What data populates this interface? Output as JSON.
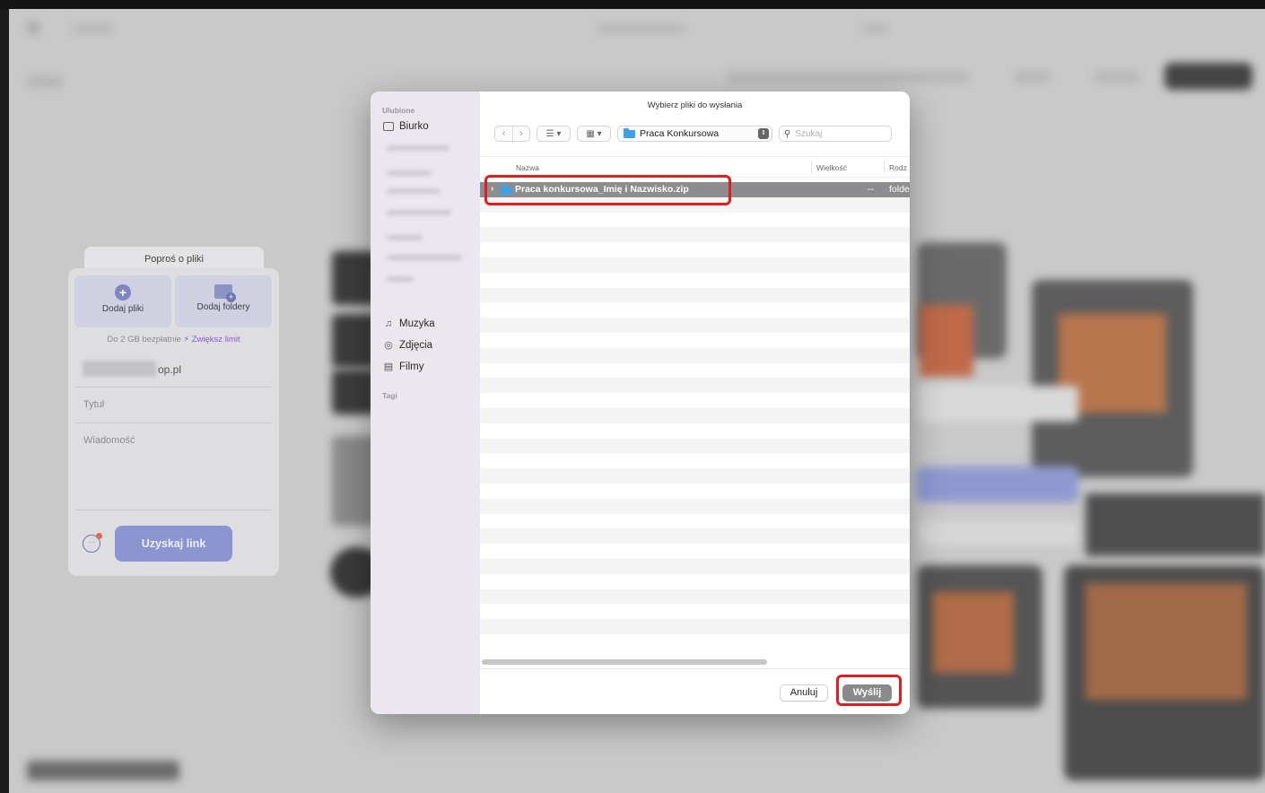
{
  "left_card": {
    "tab_label": "Poproś o pliki",
    "add_files_label": "Dodaj pliki",
    "add_folders_label": "Dodaj foldery",
    "limit_note": "Do 2 GB bezpłatnie",
    "limit_link": "Zwiększ limit",
    "email_suffix": "op.pl",
    "title_placeholder": "Tytuł",
    "message_placeholder": "Wiadomość",
    "get_link_label": "Uzyskaj link"
  },
  "dialog": {
    "title": "Wybierz pliki do wysłania",
    "sidebar": {
      "favorites_header": "Ulubione",
      "items": [
        {
          "label": "Biurko",
          "icon": "desktop-icon"
        },
        {
          "label": "Muzyka",
          "icon": "music-icon"
        },
        {
          "label": "Zdjęcia",
          "icon": "camera-icon"
        },
        {
          "label": "Filmy",
          "icon": "film-icon"
        }
      ],
      "tags_header": "Tagi"
    },
    "toolbar": {
      "location": "Praca Konkursowa",
      "search_placeholder": "Szukaj"
    },
    "columns": {
      "name": "Nazwa",
      "size": "Wielkość",
      "kind": "Rodz"
    },
    "selected_row": {
      "name": "Praca konkursowa_Imię i Nazwisko.zip",
      "size": "--",
      "kind": "folde"
    },
    "buttons": {
      "cancel": "Anuluj",
      "send": "Wyślij"
    }
  },
  "colors": {
    "highlight": "#e01e1e",
    "accent": "#8b95cf",
    "folder": "#3ea1e8"
  }
}
